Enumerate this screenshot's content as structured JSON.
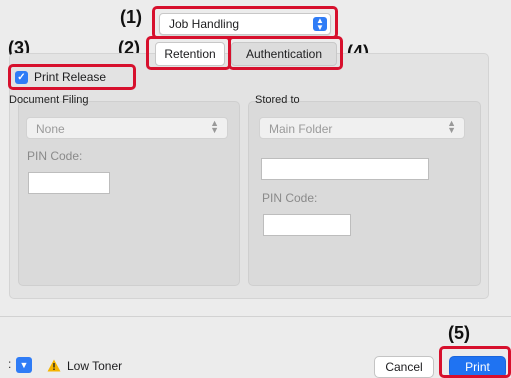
{
  "callouts": [
    "(1)",
    "(2)",
    "(3)",
    "(4)",
    "(5)"
  ],
  "job_handling_menu": {
    "value": "Job Handling"
  },
  "tabs": [
    {
      "label": "Retention",
      "selected": true
    },
    {
      "label": "Authentication",
      "selected": false
    }
  ],
  "print_release": {
    "label": "Print Release",
    "checked": true
  },
  "document_filing": {
    "heading": "Document Filing",
    "select_value": "None",
    "pin_label": "PIN Code:",
    "pin_value": ""
  },
  "stored_to": {
    "heading": "Stored to",
    "select_value": "Main Folder",
    "folder_value": "",
    "pin_label": "PIN Code:",
    "pin_value": ""
  },
  "bottom_bar": {
    "pdf_label": ":",
    "status_text": "Low Toner",
    "cancel_label": "Cancel",
    "print_label": "Print"
  },
  "colors": {
    "callout_red": "#d7102d",
    "accent_blue": "#2f7cf6"
  }
}
